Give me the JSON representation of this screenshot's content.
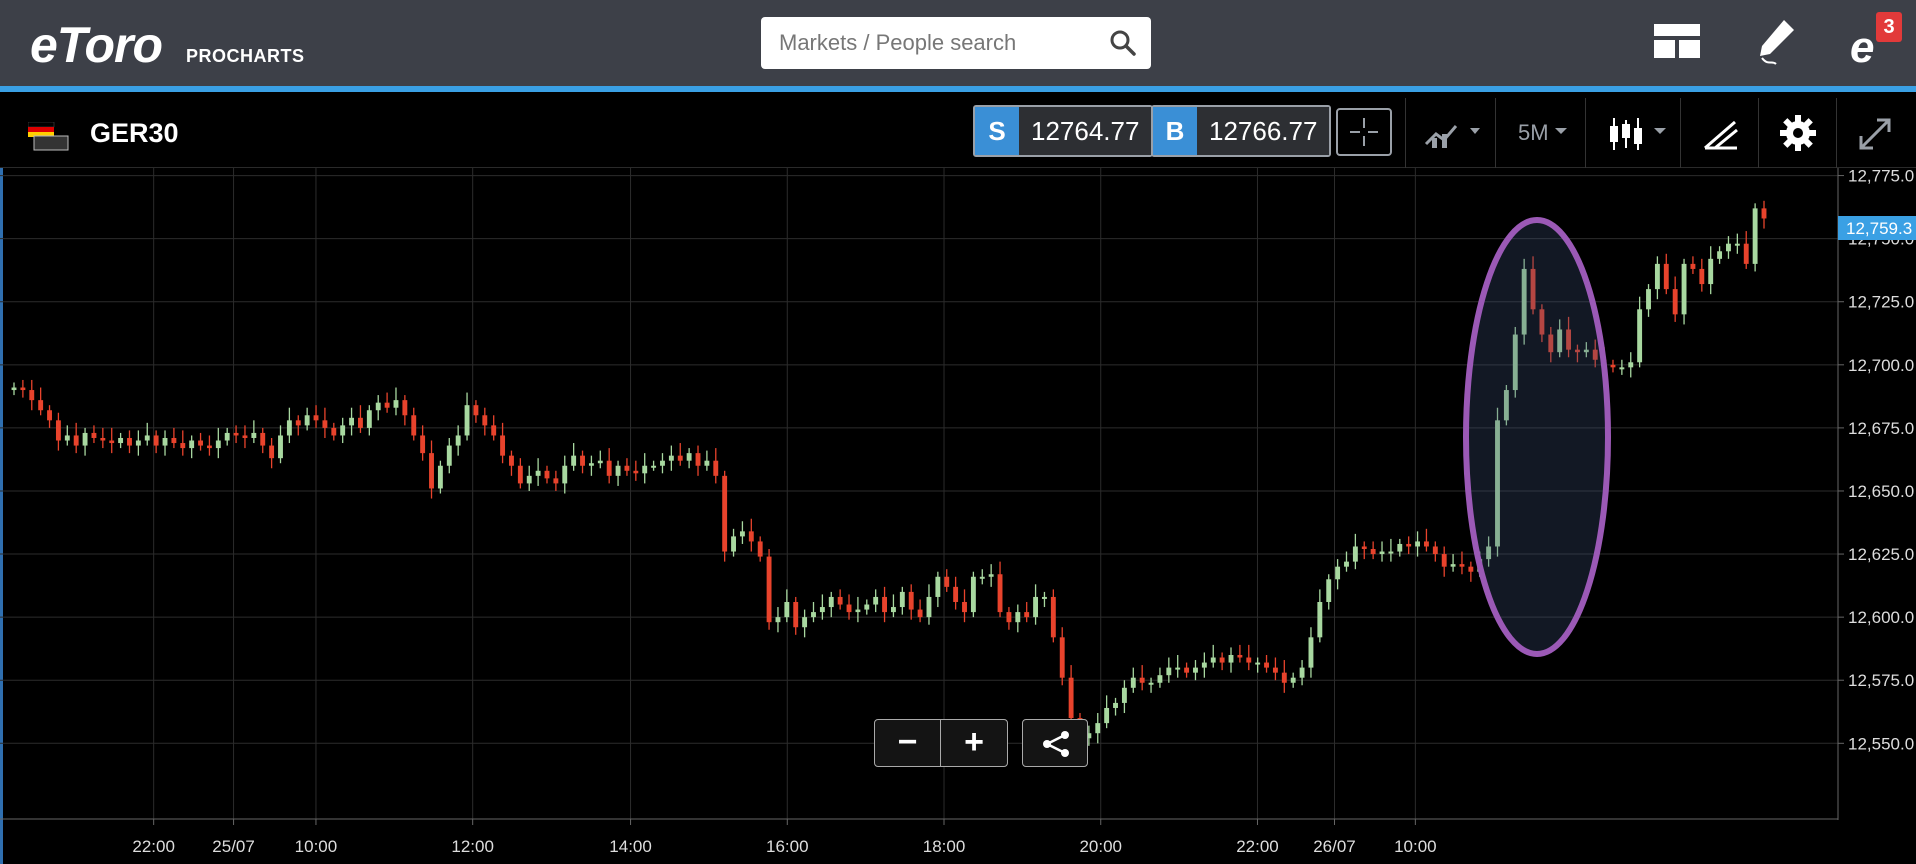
{
  "brand": {
    "logo_text": "eToro",
    "product": "PROCHARTS"
  },
  "search": {
    "placeholder": "Markets / People search"
  },
  "notifications": {
    "count": "3"
  },
  "instrument": {
    "symbol": "GER30",
    "flag_label": "GER"
  },
  "prices": {
    "sell_tag": "S",
    "sell": "12764.77",
    "buy_tag": "B",
    "buy": "12766.77"
  },
  "toolbar": {
    "timeframe": "5M"
  },
  "zoom": {
    "minus": "−",
    "plus": "+"
  },
  "icons": {
    "search": "search-icon",
    "layout": "layout-icon",
    "edit": "pencil-icon",
    "crosshair": "crosshair-icon",
    "indicators": "indicators-icon",
    "candles": "candlestick-icon",
    "drawing": "drawing-tools-icon",
    "settings": "gear-icon",
    "fullscreen": "fullscreen-icon",
    "share": "share-icon"
  },
  "colors": {
    "up": "#a8d8a0",
    "down": "#e8432c",
    "highlight": "#9b59b6",
    "accent": "#3aa0e4"
  },
  "chart_data": {
    "type": "candlestick",
    "y_ticks": [
      "12,775.0",
      "12,750.0",
      "12,725.0",
      "12,700.0",
      "12,675.0",
      "12,650.0",
      "12,625.0",
      "12,600.0",
      "12,575.0",
      "12,550.0"
    ],
    "current_price_label": "12,759.3",
    "x_ticks": [
      "22:00",
      "25/07",
      "10:00",
      "12:00",
      "14:00",
      "16:00",
      "18:00",
      "20:00",
      "22:00",
      "26/07",
      "10:00"
    ],
    "ylim": [
      12520,
      12778
    ],
    "close_series": [
      12691,
      12690,
      12686,
      12682,
      12678,
      12670,
      12672,
      12668,
      12673,
      12671,
      12670,
      12669,
      12671,
      12668,
      12670,
      12672,
      12668,
      12671,
      12669,
      12667,
      12670,
      12668,
      12667,
      12670,
      12673,
      12672,
      12671,
      12673,
      12668,
      12663,
      12672,
      12678,
      12676,
      12680,
      12678,
      12675,
      12672,
      12676,
      12679,
      12675,
      12682,
      12685,
      12683,
      12686,
      12680,
      12672,
      12665,
      12651,
      12660,
      12668,
      12672,
      12684,
      12680,
      12676,
      12672,
      12664,
      12660,
      12653,
      12656,
      12658,
      12655,
      12653,
      12660,
      12664,
      12660,
      12661,
      12662,
      12656,
      12660,
      12658,
      12657,
      12660,
      12660,
      12662,
      12664,
      12662,
      12665,
      12660,
      12662,
      12656,
      12626,
      12632,
      12634,
      12630,
      12624,
      12598,
      12600,
      12606,
      12596,
      12600,
      12602,
      12604,
      12608,
      12605,
      12602,
      12603,
      12605,
      12608,
      12602,
      12604,
      12610,
      12603,
      12600,
      12608,
      12616,
      12612,
      12606,
      12602,
      12616,
      12616,
      12617,
      12602,
      12598,
      12602,
      12600,
      12608,
      12608,
      12592,
      12576,
      12560,
      12552,
      12554,
      12558,
      12564,
      12566,
      12572,
      12576,
      12574,
      12574,
      12577,
      12580,
      12580,
      12578,
      12580,
      12582,
      12584,
      12582,
      12585,
      12584,
      12582,
      12582,
      12580,
      12578,
      12574,
      12576,
      12580,
      12592,
      12606,
      12615,
      12620,
      12622,
      12628,
      12627,
      12625,
      12626,
      12626,
      12629,
      12628,
      12630,
      12628,
      12625,
      12620,
      12621,
      12620,
      12618,
      12623,
      12628,
      12678,
      12690,
      12712,
      12738,
      12722,
      12712,
      12705,
      12714,
      12706,
      12705,
      12706,
      12702,
      12700,
      12699,
      12699,
      12701,
      12722,
      12730,
      12740,
      12730,
      12720,
      12740,
      12738,
      12732,
      12742,
      12745,
      12748,
      12748,
      12740,
      12762,
      12758
    ]
  }
}
